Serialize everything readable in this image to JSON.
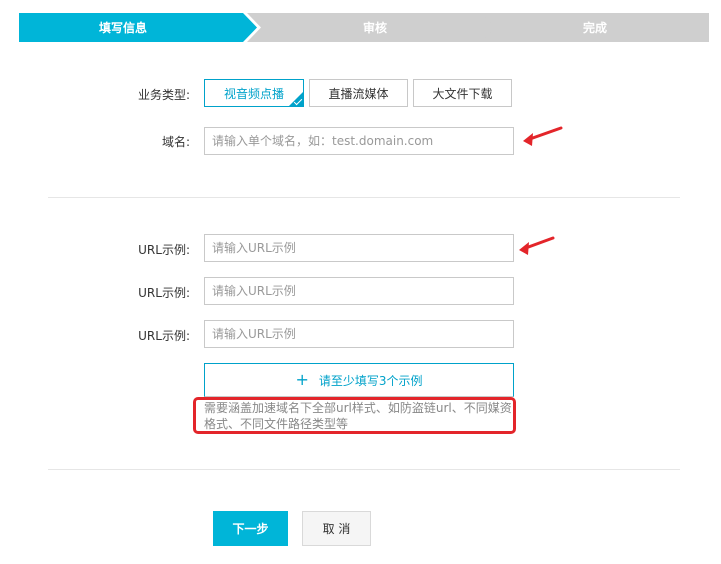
{
  "steps": {
    "step1": "填写信息",
    "step2": "审核",
    "step3": "完成"
  },
  "business_type": {
    "label": "业务类型:",
    "options": [
      "视音频点播",
      "直播流媒体",
      "大文件下载"
    ],
    "selected": "视音频点播"
  },
  "domain": {
    "label": "域名:",
    "placeholder": "请输入单个域名，如：test.domain.com",
    "value": ""
  },
  "url_examples": {
    "label": "URL示例:",
    "fields": [
      {
        "placeholder": "请输入URL示例",
        "value": ""
      },
      {
        "placeholder": "请输入URL示例",
        "value": ""
      },
      {
        "placeholder": "请输入URL示例",
        "value": ""
      }
    ],
    "add_label": "请至少填写3个示例",
    "hint": "需要涵盖加速域名下全部url样式、如防盗链url、不同媒资格式、不同文件路径类型等"
  },
  "actions": {
    "next": "下一步",
    "cancel": "取 消"
  },
  "colors": {
    "accent": "#00b5d8",
    "inactive_step": "#cfcfcf",
    "annotation_red": "#e3252a"
  }
}
